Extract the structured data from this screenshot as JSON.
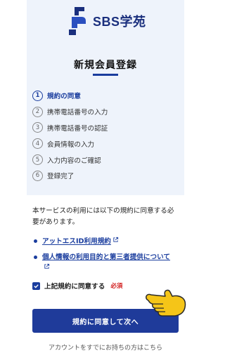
{
  "brand": {
    "name": "SBS学苑",
    "color": "#1a2f7d"
  },
  "page": {
    "title": "新規会員登録"
  },
  "steps": [
    {
      "num": "1",
      "label": "規約の同意",
      "active": true
    },
    {
      "num": "2",
      "label": "携帯電話番号の入力",
      "active": false
    },
    {
      "num": "3",
      "label": "携帯電話番号の認証",
      "active": false
    },
    {
      "num": "4",
      "label": "会員情報の入力",
      "active": false
    },
    {
      "num": "5",
      "label": "入力内容のご確認",
      "active": false
    },
    {
      "num": "6",
      "label": "登録完了",
      "active": false
    }
  ],
  "intro": "本サービスの利用には以下の規約に同意する必要があります。",
  "links": [
    {
      "label": "アットエスID利用規約"
    },
    {
      "label": "個人情報の利用目的と第三者提供について"
    }
  ],
  "agreement": {
    "label": "上記規約に同意する",
    "required": "必須",
    "checked": true
  },
  "submit": {
    "label": "規約に同意して次へ"
  },
  "footer": {
    "text": "アカウントをすでにお持ちの方はこちら"
  },
  "colors": {
    "accent": "#1f3b9a",
    "panel": "#eef3fb",
    "required": "#d21f1f"
  }
}
